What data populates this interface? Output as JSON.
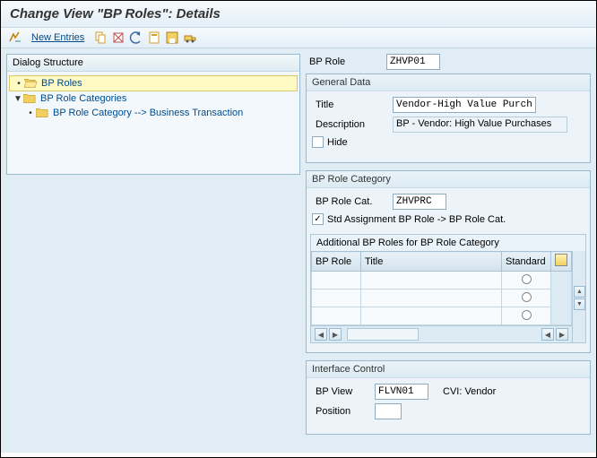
{
  "title": "Change View \"BP Roles\": Details",
  "toolbar": {
    "new_entries": "New Entries"
  },
  "dialog": {
    "header": "Dialog Structure",
    "items": [
      {
        "label": "BP Roles"
      },
      {
        "label": "BP Role Categories"
      },
      {
        "label": "BP Role Category --> Business Transaction"
      }
    ]
  },
  "bp_role": {
    "label": "BP Role",
    "value": "ZHVP01"
  },
  "general": {
    "header": "General Data",
    "title_label": "Title",
    "title_value": "Vendor-High Value Purch.",
    "desc_label": "Description",
    "desc_value": "BP - Vendor: High Value Purchases",
    "hide_label": "Hide"
  },
  "rolecat": {
    "header": "BP Role Category",
    "cat_label": "BP Role Cat.",
    "cat_value": "ZHVPRC",
    "std_label": "Std Assignment BP Role -> BP Role Cat.",
    "sub_header": "Additional BP Roles for BP Role Category",
    "col_role": "BP Role",
    "col_title": "Title",
    "col_std": "Standard"
  },
  "iface": {
    "header": "Interface Control",
    "view_label": "BP View",
    "view_value": "FLVN01",
    "view_text": "CVI: Vendor",
    "pos_label": "Position",
    "pos_value": ""
  }
}
